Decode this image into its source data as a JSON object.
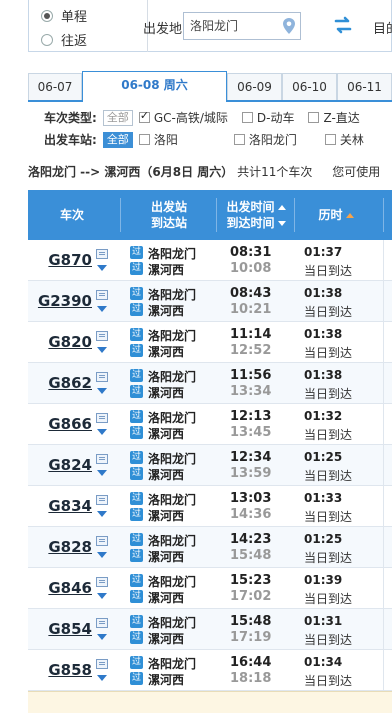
{
  "search": {
    "oneway_label": "单程",
    "roundtrip_label": "往返",
    "from_label": "出发地",
    "from_value": "洛阳龙门",
    "to_label": "目的"
  },
  "date_tabs": [
    "06-07",
    "06-08 周六",
    "06-09",
    "06-10",
    "06-11"
  ],
  "filters": {
    "type_label": "车次类型:",
    "type_all": "全部",
    "type_options": [
      "GC-高铁/城际",
      "D-动车",
      "Z-直达"
    ],
    "station_label": "出发车站:",
    "station_all": "全部",
    "station_options": [
      "洛阳",
      "洛阳龙门",
      "关林"
    ]
  },
  "summary": {
    "route": "洛阳龙门 --> 漯河西（6月8日 周六）",
    "count": "共计11个车次",
    "hint": "您可使用"
  },
  "table": {
    "col_train": "车次",
    "col_station_top": "出发站",
    "col_station_bottom": "到达站",
    "col_time_top": "出发时间",
    "col_time_bottom": "到达时间",
    "col_duration": "历时",
    "badge": "过",
    "rows": [
      {
        "train": "G870",
        "from": "洛阳龙门",
        "to": "漯河西",
        "dep": "08:31",
        "arr": "10:08",
        "dur": "01:37",
        "day": "当日到达"
      },
      {
        "train": "G2390",
        "from": "洛阳龙门",
        "to": "漯河西",
        "dep": "08:43",
        "arr": "10:21",
        "dur": "01:38",
        "day": "当日到达"
      },
      {
        "train": "G820",
        "from": "洛阳龙门",
        "to": "漯河西",
        "dep": "11:14",
        "arr": "12:52",
        "dur": "01:38",
        "day": "当日到达"
      },
      {
        "train": "G862",
        "from": "洛阳龙门",
        "to": "漯河西",
        "dep": "11:56",
        "arr": "13:34",
        "dur": "01:38",
        "day": "当日到达"
      },
      {
        "train": "G866",
        "from": "洛阳龙门",
        "to": "漯河西",
        "dep": "12:13",
        "arr": "13:45",
        "dur": "01:32",
        "day": "当日到达"
      },
      {
        "train": "G824",
        "from": "洛阳龙门",
        "to": "漯河西",
        "dep": "12:34",
        "arr": "13:59",
        "dur": "01:25",
        "day": "当日到达"
      },
      {
        "train": "G834",
        "from": "洛阳龙门",
        "to": "漯河西",
        "dep": "13:03",
        "arr": "14:36",
        "dur": "01:33",
        "day": "当日到达"
      },
      {
        "train": "G828",
        "from": "洛阳龙门",
        "to": "漯河西",
        "dep": "14:23",
        "arr": "15:48",
        "dur": "01:25",
        "day": "当日到达"
      },
      {
        "train": "G846",
        "from": "洛阳龙门",
        "to": "漯河西",
        "dep": "15:23",
        "arr": "17:02",
        "dur": "01:39",
        "day": "当日到达"
      },
      {
        "train": "G854",
        "from": "洛阳龙门",
        "to": "漯河西",
        "dep": "15:48",
        "arr": "17:19",
        "dur": "01:31",
        "day": "当日到达"
      },
      {
        "train": "G858",
        "from": "洛阳龙门",
        "to": "漯河西",
        "dep": "16:44",
        "arr": "18:18",
        "dur": "01:34",
        "day": "当日到达"
      }
    ]
  },
  "colors": {
    "header_blue": "#3a8fd8",
    "badge_blue": "#2f8fd6",
    "active_tab": "#2f79c9",
    "sort_orange": "#f7a34b"
  }
}
